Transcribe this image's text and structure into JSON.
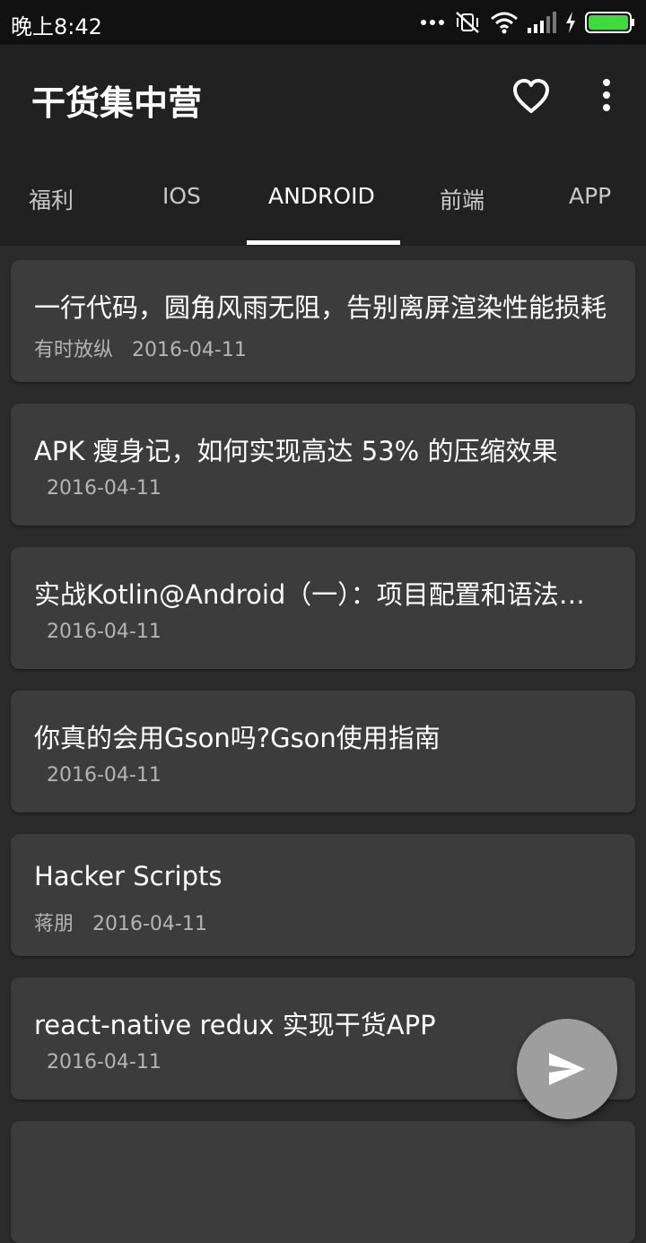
{
  "status_bar": {
    "time": "晚上8:42",
    "icons": [
      "dots-icon",
      "mute-vibrate-icon",
      "wifi-icon",
      "signal-icon",
      "charging-icon",
      "battery-icon"
    ],
    "battery_color": "#3ddc3d"
  },
  "toolbar": {
    "title": "干货集中营",
    "icons": [
      "heart-icon",
      "more-vert-icon"
    ]
  },
  "tabs": [
    {
      "label": "福利"
    },
    {
      "label": "IOS"
    },
    {
      "label": "ANDROID"
    },
    {
      "label": "前端"
    },
    {
      "label": "APP"
    }
  ],
  "active_tab": "ANDROID",
  "articles": [
    {
      "title": "一行代码，圆角风雨无阻，告别离屏渲染性能损耗",
      "meta": "有时放纵   2016-04-11"
    },
    {
      "title": "APK 瘦身记，如何实现高达 53% 的压缩效果",
      "meta": "  2016-04-11"
    },
    {
      "title": "实战Kotlin@Android（一）：项目配置和语法基础",
      "meta": "  2016-04-11"
    },
    {
      "title": "你真的会用Gson吗?Gson使用指南",
      "meta": "  2016-04-11"
    },
    {
      "title": "Hacker Scripts",
      "meta": "蒋朋   2016-04-11"
    },
    {
      "title": "react-native redux 实现干货APP",
      "meta": "  2016-04-11"
    }
  ],
  "fab": {
    "icon": "send-icon"
  },
  "colors": {
    "toolbar": "#212121",
    "background": "#2b2b2b",
    "card": "#3c3c3c",
    "fab": "#9e9e9e"
  }
}
